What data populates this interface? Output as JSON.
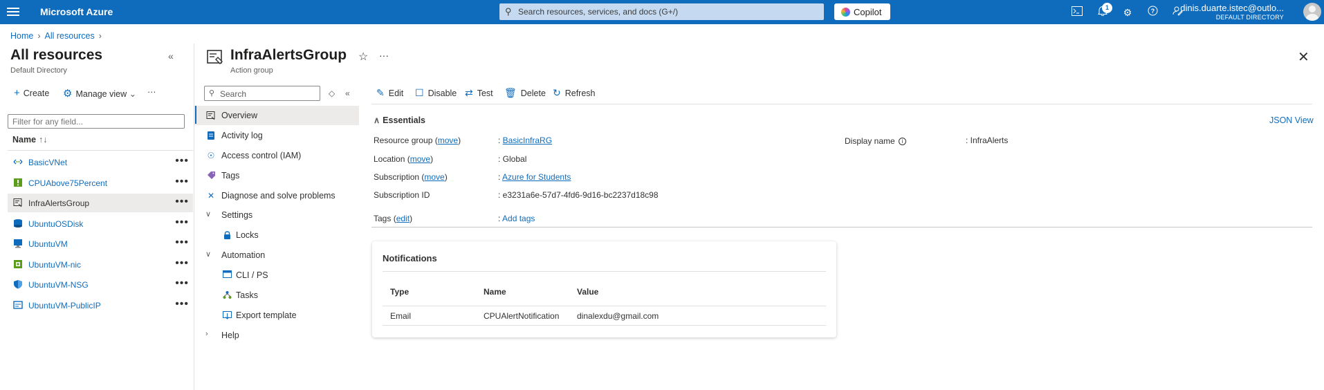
{
  "topbar": {
    "brand": "Microsoft Azure",
    "search_placeholder": "Search resources, services, and docs (G+/)",
    "copilot_label": "Copilot",
    "notification_count": "1",
    "user_email": "dinis.duarte.istec@outlo...",
    "user_directory": "DEFAULT DIRECTORY"
  },
  "breadcrumb": [
    "Home",
    "All resources"
  ],
  "left_pane": {
    "title": "All resources",
    "subtitle": "Default Directory",
    "toolbar": {
      "create": "Create",
      "manage_view": "Manage view"
    },
    "filter_placeholder": "Filter for any field...",
    "column_header": "Name",
    "resources": [
      {
        "name": "BasicVNet",
        "icon": "vnet-icon",
        "color": "#0f6cbd"
      },
      {
        "name": "CPUAbove75Percent",
        "icon": "alert-rule-icon",
        "color": "#5c9c1b"
      },
      {
        "name": "InfraAlertsGroup",
        "icon": "action-group-icon",
        "color": "#323130",
        "selected": true
      },
      {
        "name": "UbuntuOSDisk",
        "icon": "disk-icon",
        "color": "#0f6cbd"
      },
      {
        "name": "UbuntuVM",
        "icon": "vm-icon",
        "color": "#0f6cbd"
      },
      {
        "name": "UbuntuVM-nic",
        "icon": "nic-icon",
        "color": "#5c9c1b"
      },
      {
        "name": "UbuntuVM-NSG",
        "icon": "nsg-icon",
        "color": "#0f6cbd"
      },
      {
        "name": "UbuntuVM-PublicIP",
        "icon": "public-ip-icon",
        "color": "#0f6cbd"
      }
    ]
  },
  "resource": {
    "title": "InfraAlertsGroup",
    "type": "Action group",
    "search_placeholder": "Search",
    "menu": {
      "overview": "Overview",
      "activity_log": "Activity log",
      "access_control": "Access control (IAM)",
      "tags": "Tags",
      "diagnose": "Diagnose and solve problems",
      "settings": "Settings",
      "locks": "Locks",
      "automation": "Automation",
      "cli_ps": "CLI / PS",
      "tasks": "Tasks",
      "export_template": "Export template",
      "help": "Help"
    },
    "commands": {
      "edit": "Edit",
      "disable": "Disable",
      "test": "Test",
      "delete": "Delete",
      "refresh": "Refresh"
    }
  },
  "essentials": {
    "title": "Essentials",
    "json_view": "JSON View",
    "move_link": "move",
    "edit_link": "edit",
    "resource_group_label": "Resource group",
    "resource_group_value": "BasicInfraRG",
    "location_label": "Location",
    "location_value": "Global",
    "subscription_label": "Subscription",
    "subscription_value": "Azure for Students",
    "subscription_id_label": "Subscription ID",
    "subscription_id_value": "e3231a6e-57d7-4fd6-9d16-bc2237d18c98",
    "tags_label": "Tags",
    "tags_value": "Add tags",
    "display_name_label": "Display name",
    "display_name_value": "InfraAlerts"
  },
  "notifications": {
    "title": "Notifications",
    "columns": [
      "Type",
      "Name",
      "Value"
    ],
    "rows": [
      [
        "Email",
        "CPUAlertNotification",
        "dinalexdu@gmail.com"
      ]
    ]
  }
}
